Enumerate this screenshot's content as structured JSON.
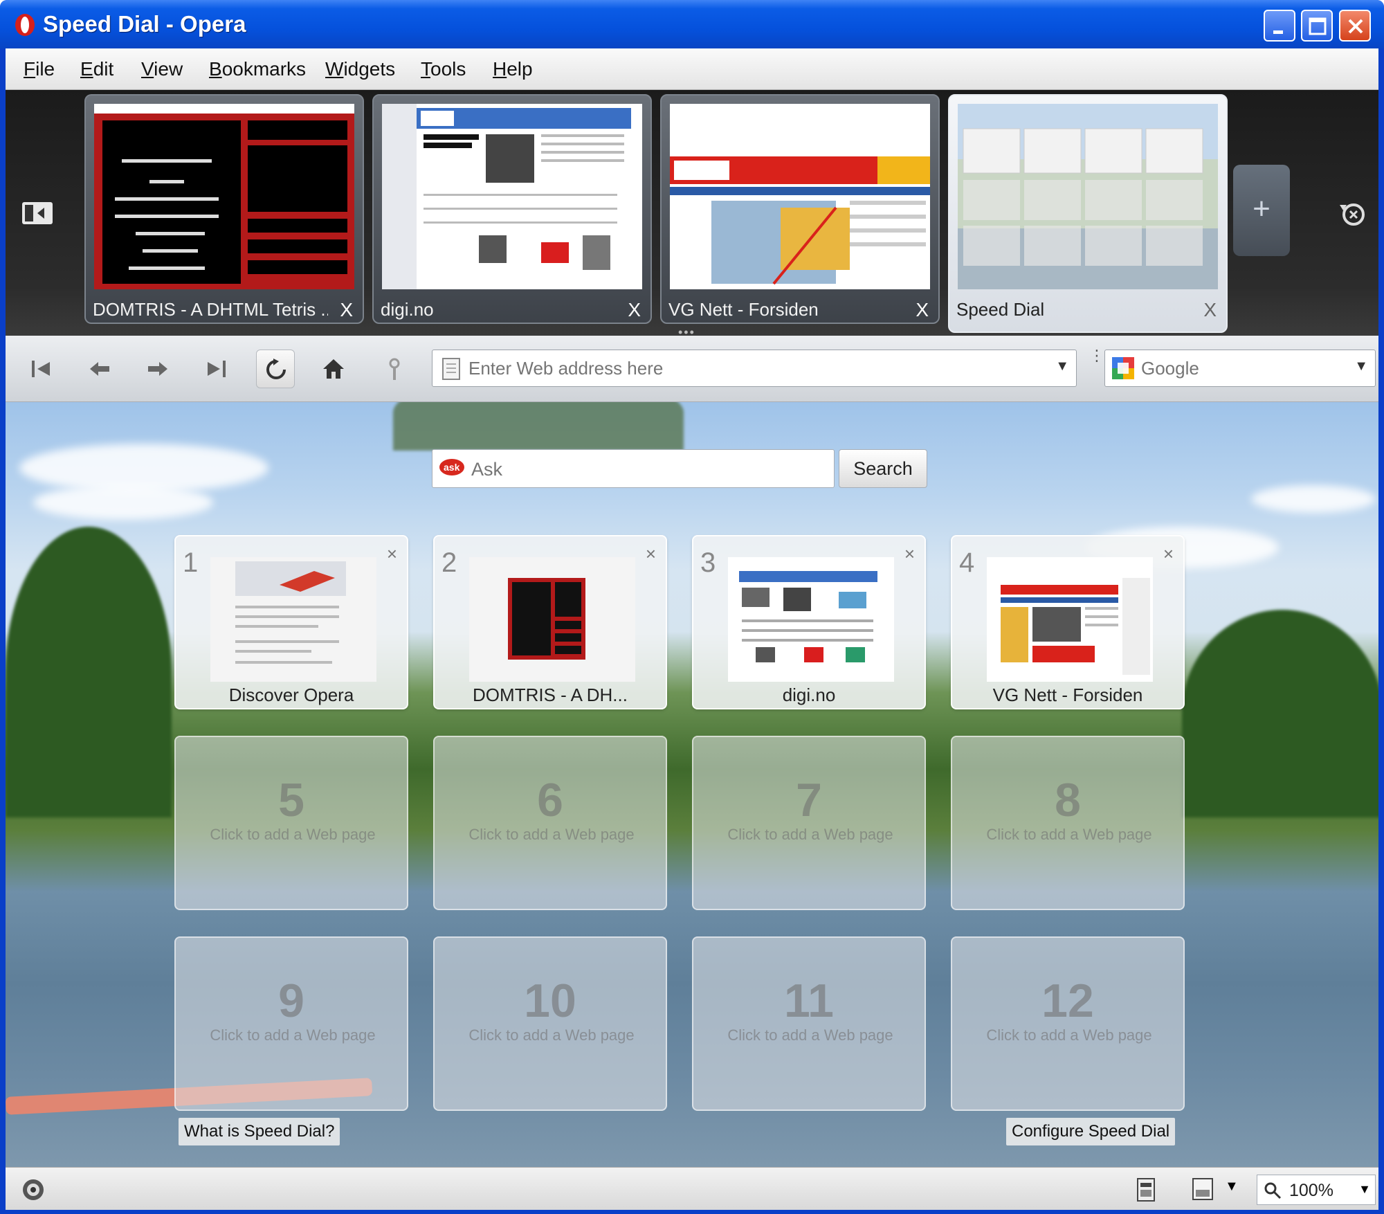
{
  "window": {
    "title": "Speed Dial - Opera",
    "colors": {
      "titlebar": "#0551dc",
      "close_button": "#d5421b"
    }
  },
  "menu": {
    "items": [
      "File",
      "Edit",
      "View",
      "Bookmarks",
      "Widgets",
      "Tools",
      "Help"
    ]
  },
  "tabs": [
    {
      "title": "DOMTRIS - A DHTML Tetris ...",
      "close": "X",
      "thumb": "domtris-game",
      "active": false
    },
    {
      "title": "digi.no",
      "close": "X",
      "thumb": "digi-news",
      "active": false
    },
    {
      "title": "VG Nett - Forsiden",
      "close": "X",
      "thumb": "vg-news",
      "active": false
    },
    {
      "title": "Speed Dial",
      "close": "X",
      "thumb": "speed-dial",
      "active": true
    }
  ],
  "tabbar": {
    "new_tab_label": "+"
  },
  "navigation": {
    "address_placeholder": "Enter Web address here",
    "search_engine_placeholder": "Google",
    "icons": [
      "rewind-icon",
      "back-icon",
      "forward-icon",
      "fast-forward-icon",
      "reload-icon",
      "home-icon",
      "wand-icon"
    ]
  },
  "speed_dial": {
    "ask_placeholder": "Ask",
    "search_button": "Search",
    "dials": [
      {
        "number": "1",
        "label": "Discover Opera",
        "close": "×"
      },
      {
        "number": "2",
        "label": "DOMTRIS - A DH...",
        "close": "×"
      },
      {
        "number": "3",
        "label": "digi.no",
        "close": "×"
      },
      {
        "number": "4",
        "label": "VG Nett - Forsiden",
        "close": "×"
      }
    ],
    "empty_dials": [
      {
        "number": "5",
        "text": "Click to add a Web page"
      },
      {
        "number": "6",
        "text": "Click to add a Web page"
      },
      {
        "number": "7",
        "text": "Click to add a Web page"
      },
      {
        "number": "8",
        "text": "Click to add a Web page"
      },
      {
        "number": "9",
        "text": "Click to add a Web page"
      },
      {
        "number": "10",
        "text": "Click to add a Web page"
      },
      {
        "number": "11",
        "text": "Click to add a Web page"
      },
      {
        "number": "12",
        "text": "Click to add a Web page"
      }
    ],
    "what_is_link": "What is Speed Dial?",
    "configure_link": "Configure Speed Dial"
  },
  "statusbar": {
    "zoom": "100%"
  }
}
